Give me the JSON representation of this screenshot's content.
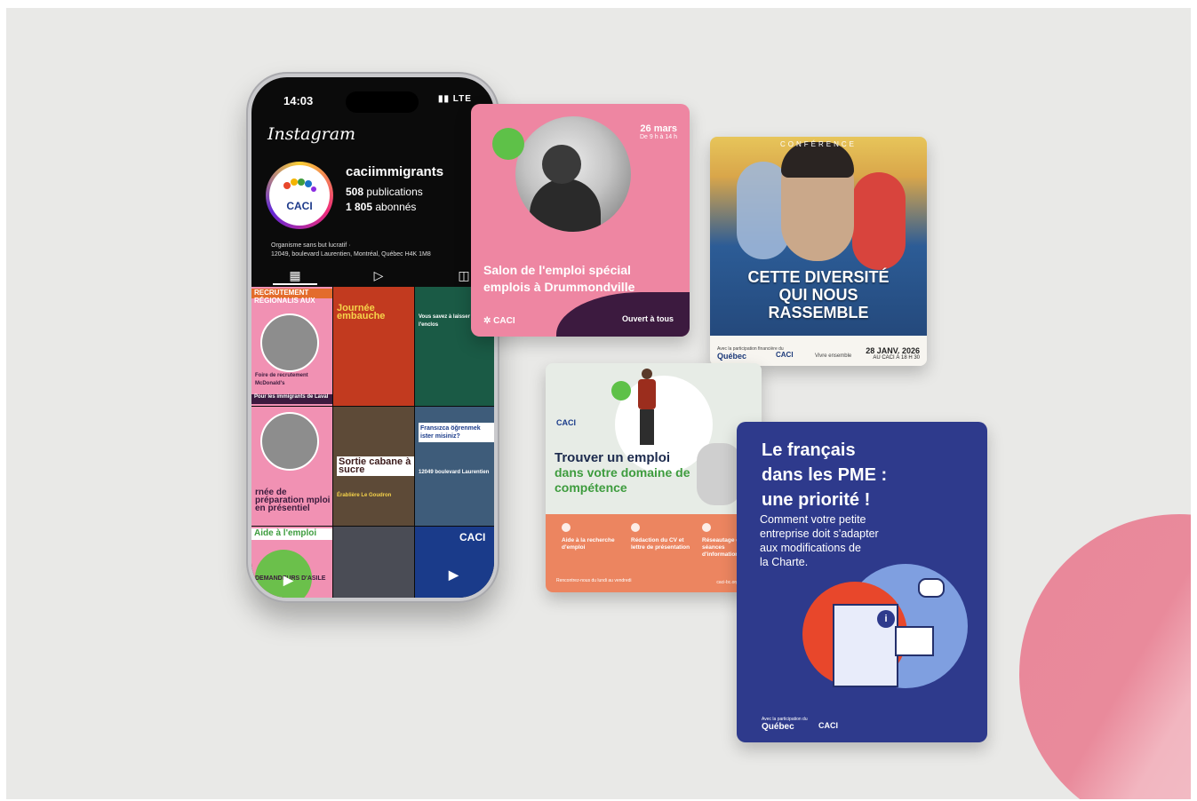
{
  "phone": {
    "time": "14:03",
    "network": "LTE",
    "app_name": "Instagram",
    "avatar_text": "CACI",
    "username": "caciimmigrants",
    "publications": "508",
    "publications_label": "publications",
    "followers": "1 805",
    "followers_label": "abonnés",
    "bio_line1": "Organisme sans but lucratif ·",
    "bio_line2": "12049, boulevard Laurentien, Montréal, Québec H4K 1M8",
    "tab_icons": [
      "grid-icon",
      "reels-icon",
      "tagged-icon"
    ],
    "grid": {
      "post1_band": "RECRUTEMENT RÉGIONALIS AUX",
      "post1_text": "Foire de recrutement McDonald's",
      "post1_bottom": "Pour les immigrants de Laval",
      "post2_text": "Journée embauche",
      "post3_text": "Vous savez à laisser de l'enclos",
      "post4_text": "rnée de préparation mploi en présentiel",
      "post5_text": "Sortie cabane à sucre",
      "post5_sub": "Érablière Le Goudron",
      "post6_text": "Fransızca öğrenmek ister misiniz?",
      "post6_sub": "12049 boulevard Laurentien",
      "post7_text": "Aide à l'emploi",
      "post7_sub": "DEMANDEURS D'ASILE",
      "post9_text": "CACI"
    }
  },
  "card1": {
    "date": "26 mars",
    "time": "De 9 h à 14 h",
    "title": "Salon de l'emploi spécial emplois à Drummondville",
    "logo": "CACI",
    "footer": "Ouvert à tous"
  },
  "card2": {
    "eyebrow": "CONFÉRENCE",
    "headline_line1": "CETTE DIVERSITÉ",
    "headline_line2": "QUI NOUS",
    "headline_line3": "RASSEMBLE",
    "sponsor_note": "Avec la participation financière du",
    "quebec": "Québec",
    "caci": "CACI",
    "vivre": "Vivre ensemble",
    "date": "28 JANV. 2026",
    "location": "AU CACI À 18 H 30"
  },
  "card3": {
    "logo": "CACI",
    "title_line1": "Trouver un emploi",
    "title_line2": "dans votre domaine de compétence",
    "services": [
      "Aide à la recherche d'emploi",
      "Rédaction du CV et lettre de présentation",
      "Réseautage et séances d'information"
    ],
    "footer_note": "Rencontrez-nous du lundi au vendredi",
    "url": "caci-bc.org/emploi"
  },
  "card4": {
    "headline_line1": "Le français",
    "headline_line2": "dans les PME :",
    "headline_line3": "une priorité !",
    "body_line1": "Comment votre petite",
    "body_line2": "entreprise doit s'adapter",
    "body_line3": "aux modifications de",
    "body_line4": "la Charte.",
    "note": "Avec la participation du",
    "quebec": "Québec",
    "caci": "CACI"
  }
}
